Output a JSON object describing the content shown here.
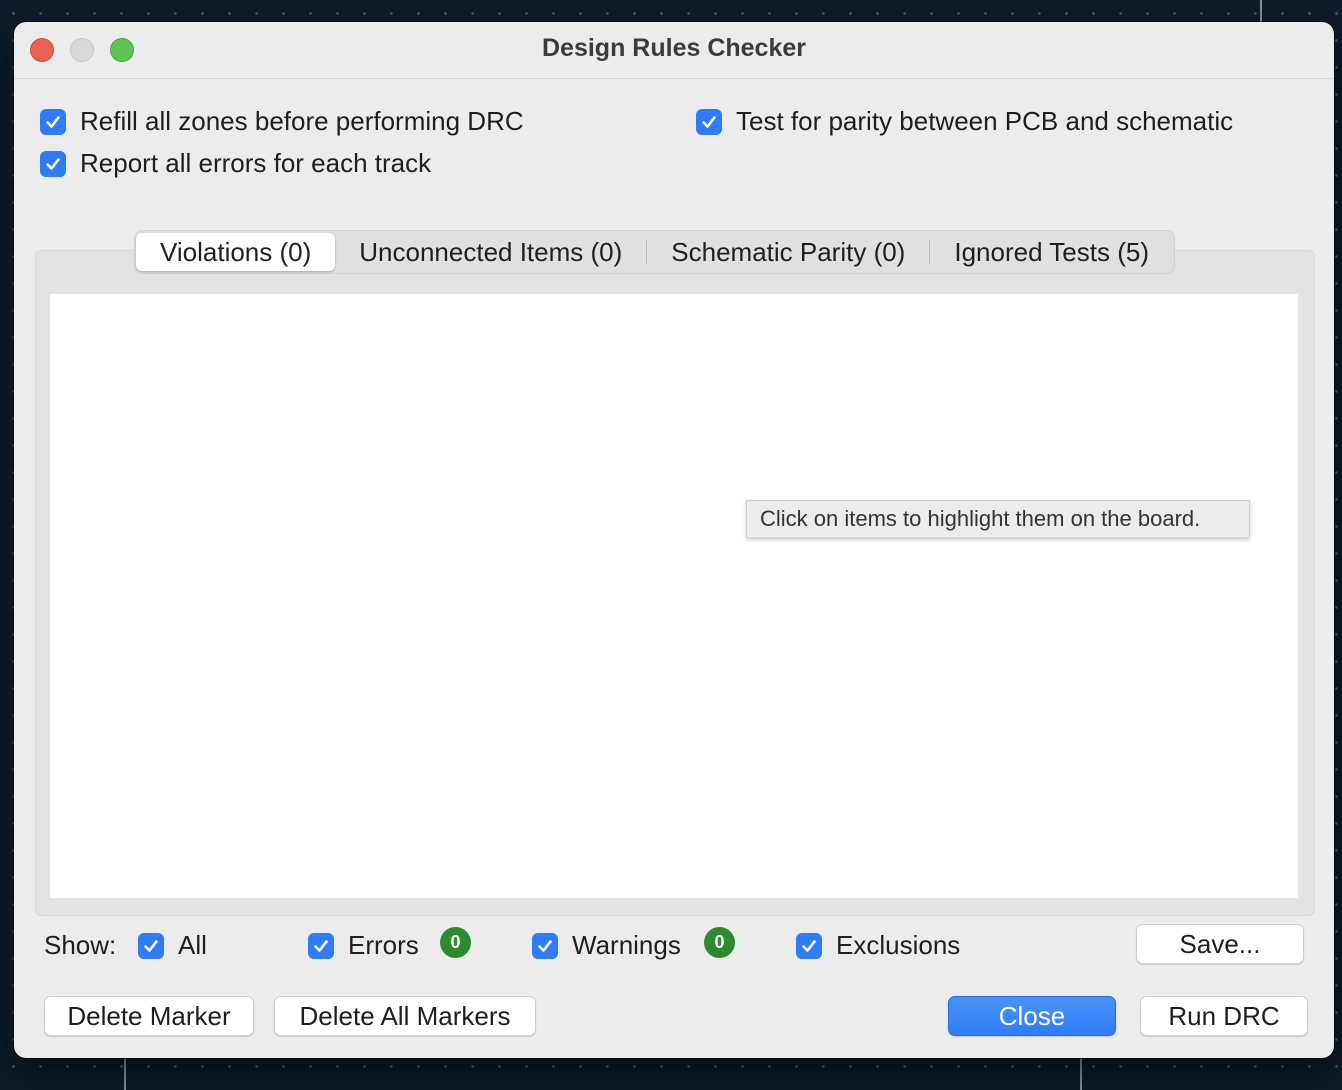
{
  "window": {
    "title": "Design Rules Checker"
  },
  "options": {
    "refill_zones": {
      "label": "Refill all zones before performing DRC",
      "checked": true
    },
    "report_all_errors": {
      "label": "Report all errors for each track",
      "checked": true
    },
    "test_parity": {
      "label": "Test for parity between PCB and schematic",
      "checked": true
    }
  },
  "tabs": [
    {
      "label": "Violations (0)",
      "active": true
    },
    {
      "label": "Unconnected Items (0)",
      "active": false
    },
    {
      "label": "Schematic Parity (0)",
      "active": false
    },
    {
      "label": "Ignored Tests (5)",
      "active": false
    }
  ],
  "tooltip": "Click on items to highlight them on the board.",
  "filters": {
    "show_label": "Show:",
    "all": {
      "label": "All",
      "checked": true
    },
    "errors": {
      "label": "Errors",
      "checked": true,
      "count": "0"
    },
    "warnings": {
      "label": "Warnings",
      "checked": true,
      "count": "0"
    },
    "exclusions": {
      "label": "Exclusions",
      "checked": true
    }
  },
  "buttons": {
    "save": "Save...",
    "delete_marker": "Delete Marker",
    "delete_all_markers": "Delete All Markers",
    "close": "Close",
    "run_drc": "Run DRC"
  },
  "colors": {
    "accent": "#2f7cf6",
    "badge_green": "#2f8a2f",
    "close_dot": "#ec5f57",
    "min_dot": "#d9d9d9",
    "max_dot": "#5fc354"
  }
}
